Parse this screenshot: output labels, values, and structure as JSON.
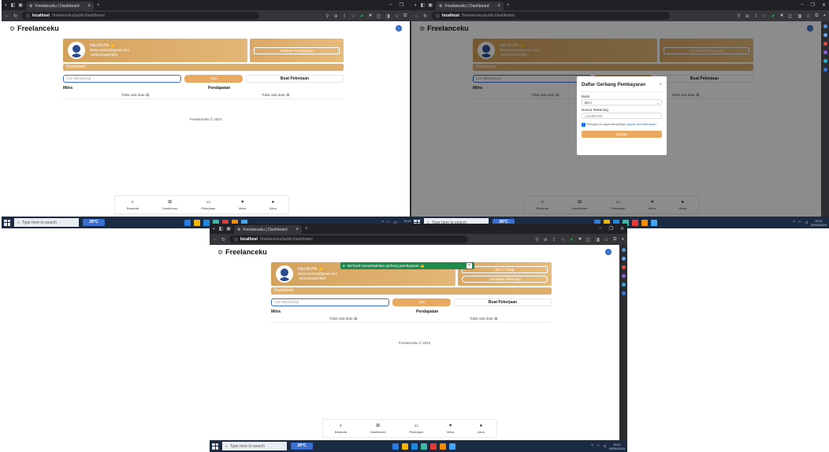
{
  "browser": {
    "tab_title": "Freelanceku | Dashboard",
    "url_host": "localhost",
    "url_path": "/freelanceku/public/dashboard",
    "win_controls": [
      "–",
      "❐",
      "✕"
    ]
  },
  "taskbar": {
    "search_placeholder": "Type here to search",
    "weather_label": "28°C",
    "time": "19:11",
    "date": "02/01/2024"
  },
  "app": {
    "brand": "Freelanceku",
    "user": {
      "name": "Hai! ALVIN 👏",
      "email": "alvinsusanto@gmail.com",
      "phone": "+6281234567890"
    },
    "payment_button": "Tambah Pembayaran",
    "payment_bank": "BCA | Tutup",
    "payment_pill": "Tampilkan Rekening",
    "dashboard_label": "Dashboard",
    "search_placeholder": "Cari Mitra/Kerja",
    "search_button": "Cari",
    "post_job_button": "Buat Pekerjaan",
    "table": {
      "headers": [
        "Mitra",
        "Pendapatan"
      ],
      "empty": [
        "Tidak ada data 😭",
        "Tidak ada data 😭"
      ]
    },
    "footer": "Freelanceku © 2024",
    "bottom_nav": [
      {
        "icon": "⌕",
        "label": "Beranda"
      },
      {
        "icon": "⊞",
        "label": "Dashboard"
      },
      {
        "icon": "▭",
        "label": "Pekerjaan"
      },
      {
        "icon": "♥",
        "label": "Mitra"
      },
      {
        "icon": "●",
        "label": "Akun"
      }
    ]
  },
  "modal": {
    "title": "Daftar Gerbang Pembayaran",
    "close": "×",
    "bank_label": "Bank",
    "bank_value": "BCA",
    "account_label": "Nomor Rekening",
    "account_value": "123456789",
    "agree_text": "Dengan ini saya menyetujui",
    "agree_link": "syarat dan ketentuan",
    "save_button": "Simpan"
  },
  "toast": {
    "message": "Berhasil menambahkan gerbang pembayaran 👍",
    "close": "✕"
  }
}
